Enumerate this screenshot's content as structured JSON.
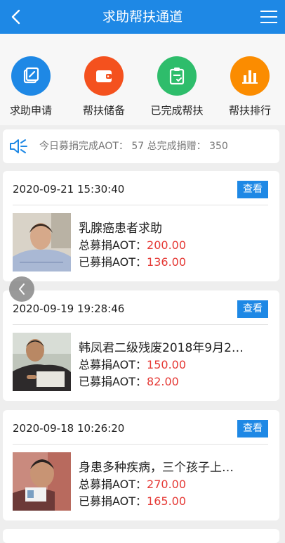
{
  "header": {
    "title": "求助帮扶通道"
  },
  "quick_actions": [
    {
      "label": "求助申请",
      "icon": "edit-icon",
      "color": "#1e88e5"
    },
    {
      "label": "帮扶储备",
      "icon": "wallet-icon",
      "color": "#f4511e"
    },
    {
      "label": "已完成帮扶",
      "icon": "clipboard-check-icon",
      "color": "#2ebd6b"
    },
    {
      "label": "帮扶排行",
      "icon": "bar-chart-icon",
      "color": "#fb8c00"
    }
  ],
  "notice": {
    "text": "今日募捐完成AOT： 57 总完成捐赠： 350"
  },
  "cards": [
    {
      "date": "2020-09-21 15:30:40",
      "view_label": "查看",
      "title": "乳腺癌患者求助",
      "total_label": "总募捐AOT：",
      "total_value": "200.00",
      "raised_label": "已募捐AOT：",
      "raised_value": "136.00"
    },
    {
      "date": "2020-09-19 19:28:46",
      "view_label": "查看",
      "title": "韩凤君二级残废2018年9月2…",
      "total_label": "总募捐AOT：",
      "total_value": "150.00",
      "raised_label": "已募捐AOT：",
      "raised_value": "82.00"
    },
    {
      "date": "2020-09-18 10:26:20",
      "view_label": "查看",
      "title": "身患多种疾病，三个孩子上…",
      "total_label": "总募捐AOT：",
      "total_value": "270.00",
      "raised_label": "已募捐AOT：",
      "raised_value": "165.00"
    }
  ],
  "colors": {
    "primary": "#1e88e5",
    "amount": "#e53935"
  }
}
